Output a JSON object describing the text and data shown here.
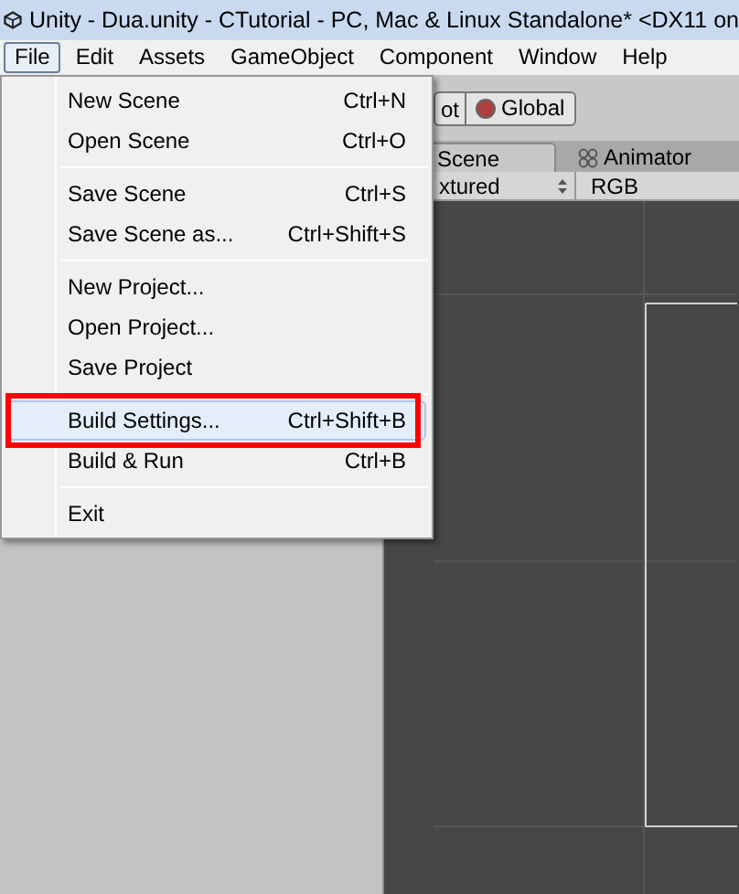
{
  "window": {
    "title": "Unity - Dua.unity - CTutorial - PC, Mac & Linux Standalone* <DX11 on"
  },
  "menubar": [
    {
      "label": "File",
      "selected": true
    },
    {
      "label": "Edit",
      "selected": false
    },
    {
      "label": "Assets",
      "selected": false
    },
    {
      "label": "GameObject",
      "selected": false
    },
    {
      "label": "Component",
      "selected": false
    },
    {
      "label": "Window",
      "selected": false
    },
    {
      "label": "Help",
      "selected": false
    }
  ],
  "toolbar": {
    "pivot_button": "ot",
    "global_button": "Global"
  },
  "tabs": [
    {
      "label": "Scene",
      "selected": true
    },
    {
      "label": "Animator",
      "selected": false
    }
  ],
  "scene_bar": {
    "shading": "xtured",
    "render_mode": "RGB"
  },
  "file_menu": [
    {
      "kind": "item",
      "label": "New Scene",
      "shortcut": "Ctrl+N",
      "selected": false,
      "annotated": false
    },
    {
      "kind": "item",
      "label": "Open Scene",
      "shortcut": "Ctrl+O",
      "selected": false,
      "annotated": false
    },
    {
      "kind": "separator"
    },
    {
      "kind": "item",
      "label": "Save Scene",
      "shortcut": "Ctrl+S",
      "selected": false,
      "annotated": false
    },
    {
      "kind": "item",
      "label": "Save Scene as...",
      "shortcut": "Ctrl+Shift+S",
      "selected": false,
      "annotated": false
    },
    {
      "kind": "separator"
    },
    {
      "kind": "item",
      "label": "New Project...",
      "selected": false,
      "annotated": false
    },
    {
      "kind": "item",
      "label": "Open Project...",
      "selected": false,
      "annotated": false
    },
    {
      "kind": "item",
      "label": "Save Project",
      "selected": false,
      "annotated": false
    },
    {
      "kind": "separator"
    },
    {
      "kind": "item",
      "label": "Build Settings...",
      "shortcut": "Ctrl+Shift+B",
      "selected": true,
      "annotated": true
    },
    {
      "kind": "item",
      "label": "Build & Run",
      "shortcut": "Ctrl+B",
      "selected": false,
      "annotated": false
    },
    {
      "kind": "separator"
    },
    {
      "kind": "item",
      "label": "Exit",
      "selected": false,
      "annotated": false
    }
  ]
}
